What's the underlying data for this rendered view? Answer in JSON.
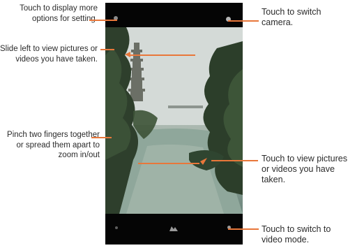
{
  "callouts": {
    "options": "Touch to display more options for setting.",
    "slide": "Slide left to view pictures or videos you have taken.",
    "pinch": "Pinch two fingers together or spread them apart to zoom in/out",
    "switch_camera": "Touch to switch camera.",
    "view_taken": "Touch to view pictures or videos you have taken.",
    "video_mode": "Touch to switch to video mode."
  },
  "colors": {
    "leader": "#e8773a",
    "phone_frame": "#050505",
    "text": "#2b2b2b"
  },
  "icons": {
    "top_left": "settings-dot-icon",
    "top_right": "switch-camera-dot-icon",
    "bottom_left": "dot-icon",
    "bottom_center": "capture-icon",
    "bottom_right": "video-mode-dot-icon"
  }
}
